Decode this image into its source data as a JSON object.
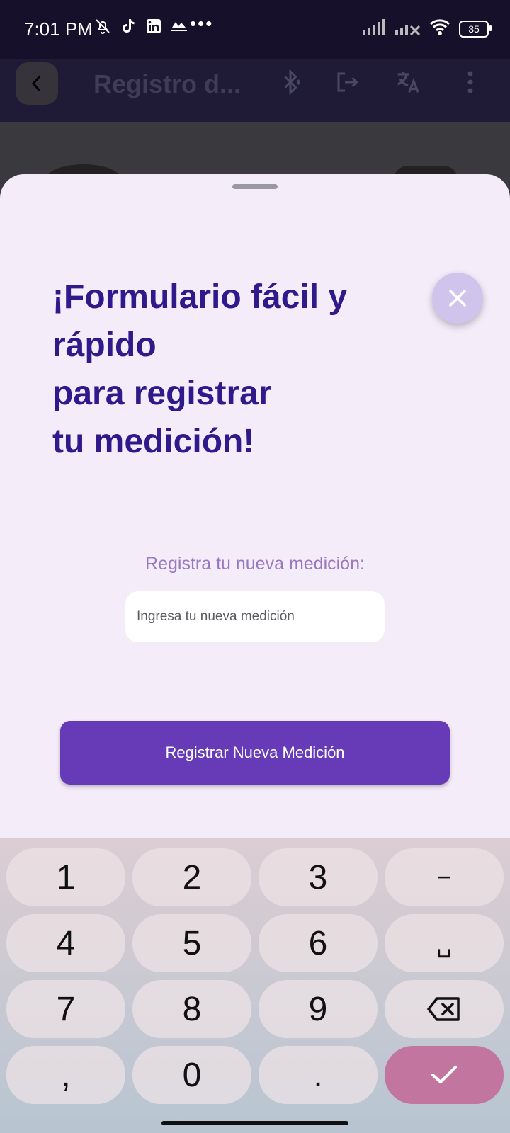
{
  "status_bar": {
    "time": "7:01 PM",
    "battery": "35",
    "icons_left": [
      "bell-off-icon",
      "tiktok-icon",
      "linkedin-icon",
      "app-icon"
    ],
    "more": "•••",
    "icons_right": [
      "signal-icon",
      "signal-no-sim-icon",
      "wifi-icon",
      "battery-icon"
    ]
  },
  "app_bar": {
    "title": "Registro d...",
    "actions": [
      "bluetooth-icon",
      "logout-icon",
      "translate-icon",
      "more-vert-icon"
    ]
  },
  "sheet": {
    "headline": "¡Formulario fácil y\nrápido\npara registrar\ntu medición!",
    "field_label": "Registra tu nueva medición:",
    "input_placeholder": "Ingresa tu nueva medición",
    "input_value": "",
    "submit_label": "Registrar Nueva Medición"
  },
  "keyboard": {
    "keys": [
      "1",
      "2",
      "3",
      "−",
      "4",
      "5",
      "6",
      "␣",
      "7",
      "8",
      "9",
      "backspace",
      ",",
      "0",
      ".",
      "✓"
    ]
  },
  "colors": {
    "headline": "#2e1a8a",
    "button": "#673ab7",
    "sheet_bg": "#f4ecf9",
    "enter_key": "#c2759f"
  }
}
